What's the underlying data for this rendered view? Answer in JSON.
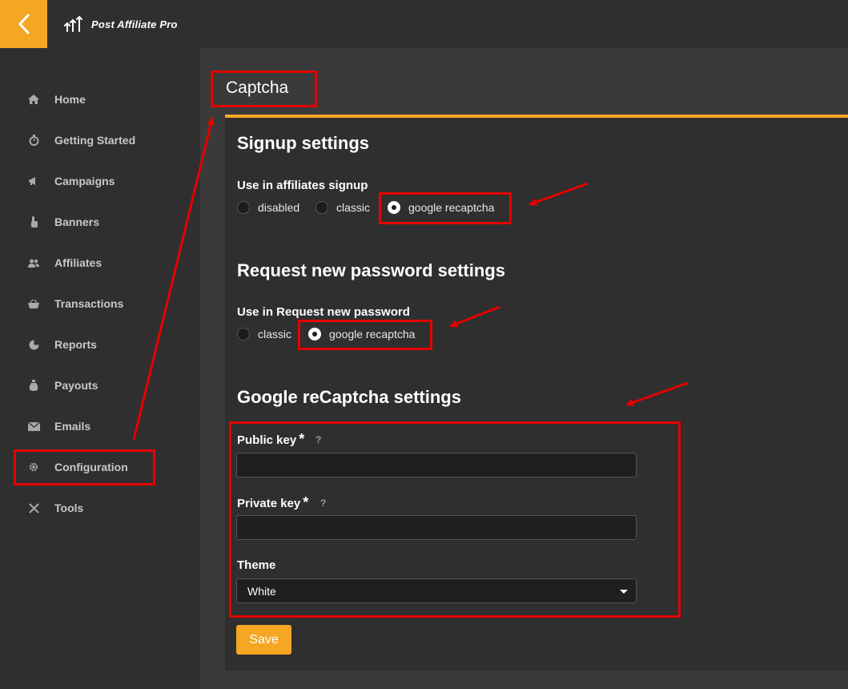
{
  "app": {
    "name": "Post Affiliate Pro"
  },
  "sidebar": {
    "items": [
      {
        "label": "Home",
        "icon": "home-icon"
      },
      {
        "label": "Getting Started",
        "icon": "stopwatch-icon"
      },
      {
        "label": "Campaigns",
        "icon": "megaphone-icon"
      },
      {
        "label": "Banners",
        "icon": "hand-pointer-icon"
      },
      {
        "label": "Affiliates",
        "icon": "users-icon"
      },
      {
        "label": "Transactions",
        "icon": "basket-icon"
      },
      {
        "label": "Reports",
        "icon": "pie-chart-icon"
      },
      {
        "label": "Payouts",
        "icon": "money-bag-icon"
      },
      {
        "label": "Emails",
        "icon": "envelope-icon"
      },
      {
        "label": "Configuration",
        "icon": "gear-icon"
      },
      {
        "label": "Tools",
        "icon": "tools-icon"
      }
    ]
  },
  "page": {
    "title": "Captcha"
  },
  "signup": {
    "title": "Signup settings",
    "label": "Use in affiliates signup",
    "options": [
      "disabled",
      "classic",
      "google recaptcha"
    ],
    "selected": "google recaptcha"
  },
  "password": {
    "title": "Request new password settings",
    "label": "Use in Request new password",
    "options": [
      "classic",
      "google recaptcha"
    ],
    "selected": "google recaptcha"
  },
  "recaptcha": {
    "title": "Google reCaptcha settings",
    "public_key_label": "Public key",
    "private_key_label": "Private key",
    "required_mark": "*",
    "help_mark": "?",
    "public_key_value": "",
    "private_key_value": "",
    "theme_label": "Theme",
    "theme_value": "White"
  },
  "actions": {
    "save_label": "Save"
  },
  "colors": {
    "accent": "#f5a623",
    "annotation": "#e60000",
    "sidebar_bg": "#2f2f2f",
    "card_bg": "#2f2f2f"
  }
}
